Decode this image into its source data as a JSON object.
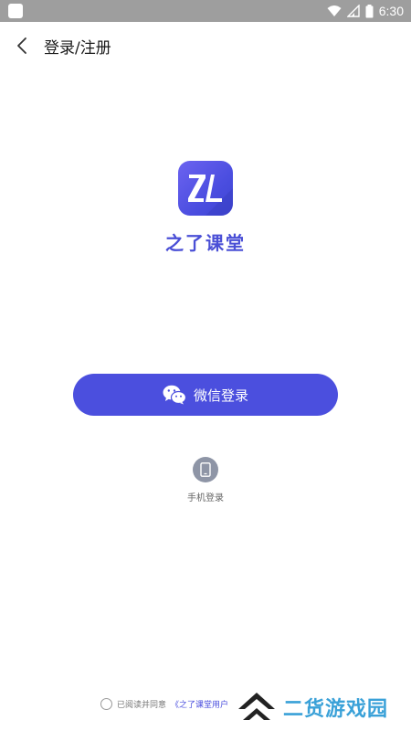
{
  "status_bar": {
    "time": "6:30",
    "icons": [
      "app-notification-icon",
      "wifi-icon",
      "signal-icon",
      "battery-icon"
    ]
  },
  "header": {
    "title": "登录/注册",
    "back_icon": "chevron-left-icon"
  },
  "app": {
    "logo_icon": "zl-logo-icon",
    "name": "之了课堂",
    "brand_color": "#4b4fde"
  },
  "login": {
    "wechat_label": "微信登录",
    "wechat_icon": "wechat-icon",
    "phone_label": "手机登录",
    "phone_icon": "phone-icon"
  },
  "agreement": {
    "prefix": "已阅读并同意",
    "link": "《之了课堂用户"
  },
  "watermark": {
    "text": "二货游戏园",
    "logo_icon": "chevron-up-logo-icon"
  }
}
